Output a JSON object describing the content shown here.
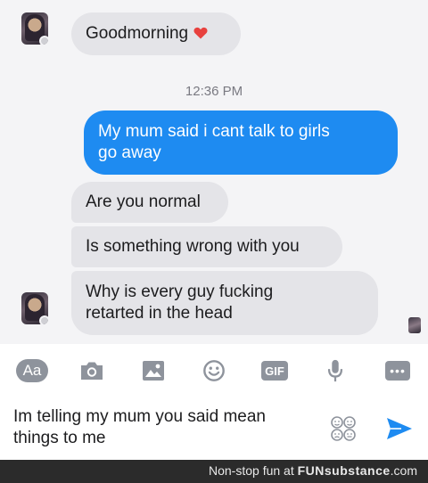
{
  "messages": {
    "first": "Goodmorning",
    "timestamp": "12:36 PM",
    "outgoing": [
      "My mum said i cant talk to girls",
      "go away"
    ],
    "reply_1": "Are you normal",
    "reply_2": "Is something wrong with you",
    "reply_3": [
      "Why is every guy fucking",
      "retarted in the head"
    ]
  },
  "toolbar": {
    "text_format_label": "Aa",
    "gif_label": "GIF",
    "more_label": "•••",
    "icons": [
      "text-format-icon",
      "camera-icon",
      "image-icon",
      "emoji-icon",
      "gif-icon",
      "microphone-icon",
      "more-icon"
    ]
  },
  "composer": {
    "value_lines": [
      "Im telling my mum you said mean",
      "things to me"
    ],
    "icons": [
      "sticker-icon",
      "send-icon"
    ]
  },
  "footer": {
    "prefix": "Non-stop fun at ",
    "brand": "FUNsubstance",
    "suffix": ".com"
  },
  "colors": {
    "outgoing_bubble": "#1e8bf1",
    "incoming_bubble": "#e4e4e8",
    "heart": "#e8413e",
    "icon_gray": "#8e939c",
    "send_blue": "#1e8bf1"
  }
}
